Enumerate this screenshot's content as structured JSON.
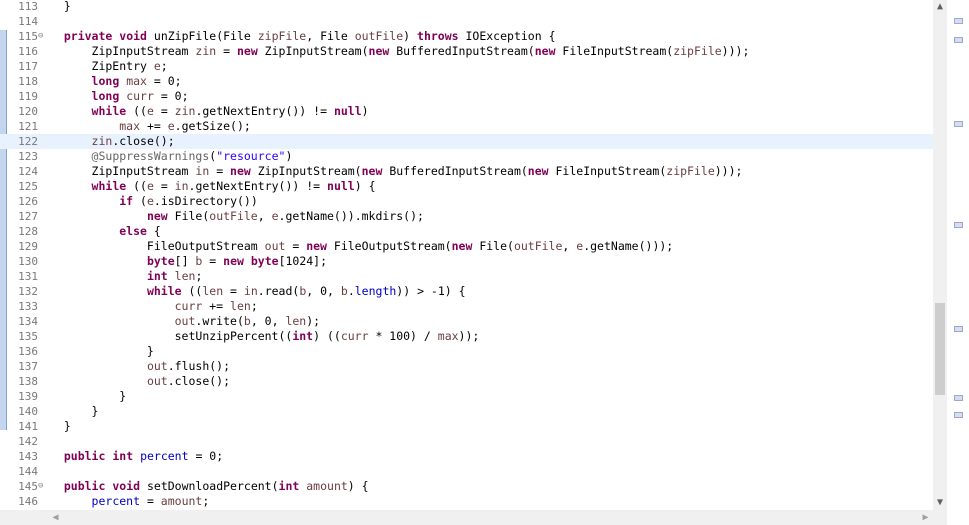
{
  "editor": {
    "lines": [
      {
        "num": "113",
        "segments": [
          {
            "t": "  }",
            "c": ""
          }
        ]
      },
      {
        "num": "114",
        "segments": []
      },
      {
        "num": "115",
        "fold": true,
        "segments": [
          {
            "t": "  ",
            "c": ""
          },
          {
            "t": "private",
            "c": "kw"
          },
          {
            "t": " ",
            "c": ""
          },
          {
            "t": "void",
            "c": "kw"
          },
          {
            "t": " unZipFile(File ",
            "c": ""
          },
          {
            "t": "zipFile",
            "c": "par"
          },
          {
            "t": ", File ",
            "c": ""
          },
          {
            "t": "outFile",
            "c": "par"
          },
          {
            "t": ") ",
            "c": ""
          },
          {
            "t": "throws",
            "c": "kw"
          },
          {
            "t": " IOException {",
            "c": ""
          }
        ]
      },
      {
        "num": "116",
        "segments": [
          {
            "t": "      ZipInputStream ",
            "c": ""
          },
          {
            "t": "zin",
            "c": "par"
          },
          {
            "t": " = ",
            "c": ""
          },
          {
            "t": "new",
            "c": "kw"
          },
          {
            "t": " ZipInputStream(",
            "c": ""
          },
          {
            "t": "new",
            "c": "kw"
          },
          {
            "t": " BufferedInputStream(",
            "c": ""
          },
          {
            "t": "new",
            "c": "kw"
          },
          {
            "t": " FileInputStream(",
            "c": ""
          },
          {
            "t": "zipFile",
            "c": "par"
          },
          {
            "t": ")));",
            "c": ""
          }
        ]
      },
      {
        "num": "117",
        "segments": [
          {
            "t": "      ZipEntry ",
            "c": ""
          },
          {
            "t": "e",
            "c": "par"
          },
          {
            "t": ";",
            "c": ""
          }
        ]
      },
      {
        "num": "118",
        "segments": [
          {
            "t": "      ",
            "c": ""
          },
          {
            "t": "long",
            "c": "kw"
          },
          {
            "t": " ",
            "c": ""
          },
          {
            "t": "max",
            "c": "par"
          },
          {
            "t": " = 0;",
            "c": ""
          }
        ]
      },
      {
        "num": "119",
        "segments": [
          {
            "t": "      ",
            "c": ""
          },
          {
            "t": "long",
            "c": "kw"
          },
          {
            "t": " ",
            "c": ""
          },
          {
            "t": "curr",
            "c": "par"
          },
          {
            "t": " = 0;",
            "c": ""
          }
        ]
      },
      {
        "num": "120",
        "segments": [
          {
            "t": "      ",
            "c": ""
          },
          {
            "t": "while",
            "c": "kw"
          },
          {
            "t": " ((",
            "c": ""
          },
          {
            "t": "e",
            "c": "par"
          },
          {
            "t": " = ",
            "c": ""
          },
          {
            "t": "zin",
            "c": "par"
          },
          {
            "t": ".getNextEntry()) != ",
            "c": ""
          },
          {
            "t": "null",
            "c": "kw"
          },
          {
            "t": ")",
            "c": ""
          }
        ]
      },
      {
        "num": "121",
        "segments": [
          {
            "t": "          ",
            "c": ""
          },
          {
            "t": "max",
            "c": "par"
          },
          {
            "t": " += ",
            "c": ""
          },
          {
            "t": "e",
            "c": "par"
          },
          {
            "t": ".getSize();",
            "c": ""
          }
        ]
      },
      {
        "num": "122",
        "current": true,
        "segments": [
          {
            "t": "      ",
            "c": ""
          },
          {
            "t": "zin",
            "c": "par"
          },
          {
            "t": ".close();",
            "c": ""
          }
        ]
      },
      {
        "num": "123",
        "segments": [
          {
            "t": "      ",
            "c": ""
          },
          {
            "t": "@SuppressWarnings",
            "c": "ann"
          },
          {
            "t": "(",
            "c": ""
          },
          {
            "t": "\"resource\"",
            "c": "str"
          },
          {
            "t": ")",
            "c": ""
          }
        ]
      },
      {
        "num": "124",
        "segments": [
          {
            "t": "      ZipInputStream ",
            "c": ""
          },
          {
            "t": "in",
            "c": "par"
          },
          {
            "t": " = ",
            "c": ""
          },
          {
            "t": "new",
            "c": "kw"
          },
          {
            "t": " ZipInputStream(",
            "c": ""
          },
          {
            "t": "new",
            "c": "kw"
          },
          {
            "t": " BufferedInputStream(",
            "c": ""
          },
          {
            "t": "new",
            "c": "kw"
          },
          {
            "t": " FileInputStream(",
            "c": ""
          },
          {
            "t": "zipFile",
            "c": "par"
          },
          {
            "t": ")));",
            "c": ""
          }
        ]
      },
      {
        "num": "125",
        "segments": [
          {
            "t": "      ",
            "c": ""
          },
          {
            "t": "while",
            "c": "kw"
          },
          {
            "t": " ((",
            "c": ""
          },
          {
            "t": "e",
            "c": "par"
          },
          {
            "t": " = ",
            "c": ""
          },
          {
            "t": "in",
            "c": "par"
          },
          {
            "t": ".getNextEntry()) != ",
            "c": ""
          },
          {
            "t": "null",
            "c": "kw"
          },
          {
            "t": ") {",
            "c": ""
          }
        ]
      },
      {
        "num": "126",
        "segments": [
          {
            "t": "          ",
            "c": ""
          },
          {
            "t": "if",
            "c": "kw"
          },
          {
            "t": " (",
            "c": ""
          },
          {
            "t": "e",
            "c": "par"
          },
          {
            "t": ".isDirectory())",
            "c": ""
          }
        ]
      },
      {
        "num": "127",
        "segments": [
          {
            "t": "              ",
            "c": ""
          },
          {
            "t": "new",
            "c": "kw"
          },
          {
            "t": " File(",
            "c": ""
          },
          {
            "t": "outFile",
            "c": "par"
          },
          {
            "t": ", ",
            "c": ""
          },
          {
            "t": "e",
            "c": "par"
          },
          {
            "t": ".getName()).mkdirs();",
            "c": ""
          }
        ]
      },
      {
        "num": "128",
        "segments": [
          {
            "t": "          ",
            "c": ""
          },
          {
            "t": "else",
            "c": "kw"
          },
          {
            "t": " {",
            "c": ""
          }
        ]
      },
      {
        "num": "129",
        "segments": [
          {
            "t": "              FileOutputStream ",
            "c": ""
          },
          {
            "t": "out",
            "c": "par"
          },
          {
            "t": " = ",
            "c": ""
          },
          {
            "t": "new",
            "c": "kw"
          },
          {
            "t": " FileOutputStream(",
            "c": ""
          },
          {
            "t": "new",
            "c": "kw"
          },
          {
            "t": " File(",
            "c": ""
          },
          {
            "t": "outFile",
            "c": "par"
          },
          {
            "t": ", ",
            "c": ""
          },
          {
            "t": "e",
            "c": "par"
          },
          {
            "t": ".getName()));",
            "c": ""
          }
        ]
      },
      {
        "num": "130",
        "segments": [
          {
            "t": "              ",
            "c": ""
          },
          {
            "t": "byte",
            "c": "kw"
          },
          {
            "t": "[] ",
            "c": ""
          },
          {
            "t": "b",
            "c": "par"
          },
          {
            "t": " = ",
            "c": ""
          },
          {
            "t": "new",
            "c": "kw"
          },
          {
            "t": " ",
            "c": ""
          },
          {
            "t": "byte",
            "c": "kw"
          },
          {
            "t": "[1024];",
            "c": ""
          }
        ]
      },
      {
        "num": "131",
        "segments": [
          {
            "t": "              ",
            "c": ""
          },
          {
            "t": "int",
            "c": "kw"
          },
          {
            "t": " ",
            "c": ""
          },
          {
            "t": "len",
            "c": "par"
          },
          {
            "t": ";",
            "c": ""
          }
        ]
      },
      {
        "num": "132",
        "segments": [
          {
            "t": "              ",
            "c": ""
          },
          {
            "t": "while",
            "c": "kw"
          },
          {
            "t": " ((",
            "c": ""
          },
          {
            "t": "len",
            "c": "par"
          },
          {
            "t": " = ",
            "c": ""
          },
          {
            "t": "in",
            "c": "par"
          },
          {
            "t": ".read(",
            "c": ""
          },
          {
            "t": "b",
            "c": "par"
          },
          {
            "t": ", 0, ",
            "c": ""
          },
          {
            "t": "b",
            "c": "par"
          },
          {
            "t": ".",
            "c": ""
          },
          {
            "t": "length",
            "c": "fld"
          },
          {
            "t": ")) > -1) {",
            "c": ""
          }
        ]
      },
      {
        "num": "133",
        "segments": [
          {
            "t": "                  ",
            "c": ""
          },
          {
            "t": "curr",
            "c": "par"
          },
          {
            "t": " += ",
            "c": ""
          },
          {
            "t": "len",
            "c": "par"
          },
          {
            "t": ";",
            "c": ""
          }
        ]
      },
      {
        "num": "134",
        "segments": [
          {
            "t": "                  ",
            "c": ""
          },
          {
            "t": "out",
            "c": "par"
          },
          {
            "t": ".write(",
            "c": ""
          },
          {
            "t": "b",
            "c": "par"
          },
          {
            "t": ", 0, ",
            "c": ""
          },
          {
            "t": "len",
            "c": "par"
          },
          {
            "t": ");",
            "c": ""
          }
        ]
      },
      {
        "num": "135",
        "segments": [
          {
            "t": "                  setUnzipPercent((",
            "c": ""
          },
          {
            "t": "int",
            "c": "kw"
          },
          {
            "t": ") ((",
            "c": ""
          },
          {
            "t": "curr",
            "c": "par"
          },
          {
            "t": " * 100) / ",
            "c": ""
          },
          {
            "t": "max",
            "c": "par"
          },
          {
            "t": "));",
            "c": ""
          }
        ]
      },
      {
        "num": "136",
        "segments": [
          {
            "t": "              }",
            "c": ""
          }
        ]
      },
      {
        "num": "137",
        "segments": [
          {
            "t": "              ",
            "c": ""
          },
          {
            "t": "out",
            "c": "par"
          },
          {
            "t": ".flush();",
            "c": ""
          }
        ]
      },
      {
        "num": "138",
        "segments": [
          {
            "t": "              ",
            "c": ""
          },
          {
            "t": "out",
            "c": "par"
          },
          {
            "t": ".close();",
            "c": ""
          }
        ]
      },
      {
        "num": "139",
        "segments": [
          {
            "t": "          }",
            "c": ""
          }
        ]
      },
      {
        "num": "140",
        "segments": [
          {
            "t": "      }",
            "c": ""
          }
        ]
      },
      {
        "num": "141",
        "segments": [
          {
            "t": "  }",
            "c": ""
          }
        ]
      },
      {
        "num": "142",
        "segments": []
      },
      {
        "num": "143",
        "segments": [
          {
            "t": "  ",
            "c": ""
          },
          {
            "t": "public",
            "c": "kw"
          },
          {
            "t": " ",
            "c": ""
          },
          {
            "t": "int",
            "c": "kw"
          },
          {
            "t": " ",
            "c": ""
          },
          {
            "t": "percent",
            "c": "fld"
          },
          {
            "t": " = 0;",
            "c": ""
          }
        ]
      },
      {
        "num": "144",
        "segments": []
      },
      {
        "num": "145",
        "fold": true,
        "segments": [
          {
            "t": "  ",
            "c": ""
          },
          {
            "t": "public",
            "c": "kw"
          },
          {
            "t": " ",
            "c": ""
          },
          {
            "t": "void",
            "c": "kw"
          },
          {
            "t": " setDownloadPercent(",
            "c": ""
          },
          {
            "t": "int",
            "c": "kw"
          },
          {
            "t": " ",
            "c": ""
          },
          {
            "t": "amount",
            "c": "par"
          },
          {
            "t": ") {",
            "c": ""
          }
        ]
      },
      {
        "num": "146",
        "segments": [
          {
            "t": "      ",
            "c": ""
          },
          {
            "t": "percent",
            "c": "fld"
          },
          {
            "t": " = ",
            "c": ""
          },
          {
            "t": "amount",
            "c": "par"
          },
          {
            "t": ";",
            "c": ""
          }
        ]
      }
    ]
  },
  "icons": {
    "fold": "minus-circle-icon",
    "scroll_up": "chevron-up-icon",
    "scroll_down": "chevron-down-icon",
    "scroll_left": "chevron-left-icon",
    "scroll_right": "chevron-right-icon"
  },
  "colors": {
    "keyword": "#7f0055",
    "field": "#0000c0",
    "parameter": "#6a3e3e",
    "string": "#2a00ff",
    "annotation": "#646464",
    "current_line": "#e8f2fe"
  }
}
